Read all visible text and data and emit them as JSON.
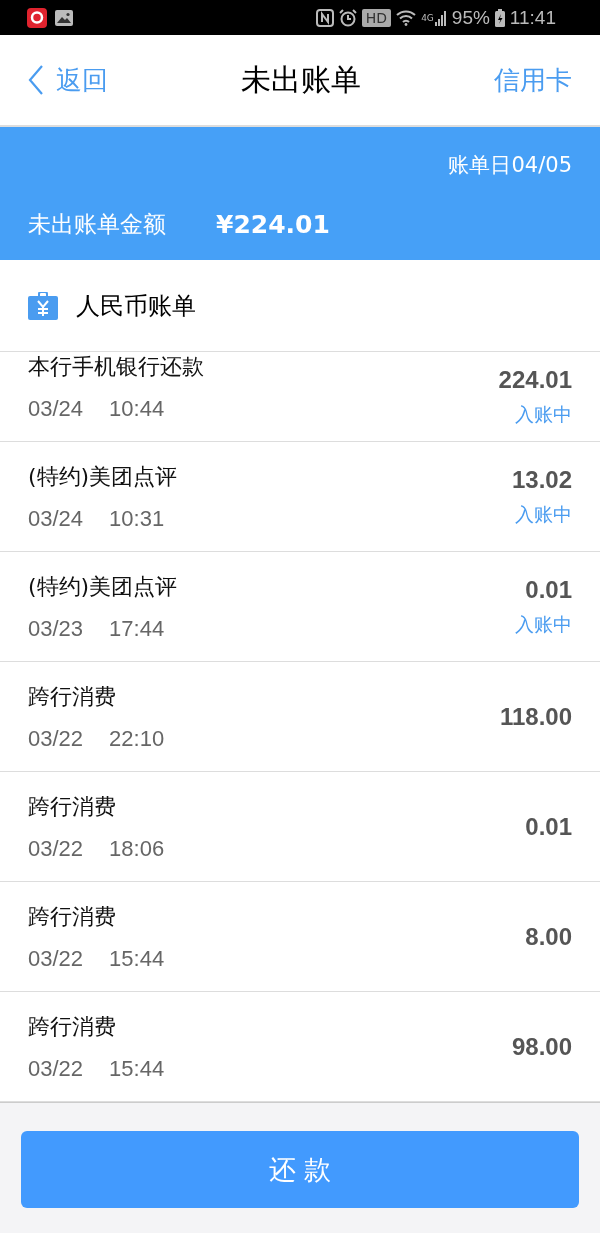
{
  "status_bar": {
    "network": "4G",
    "hd": "HD",
    "battery": "95%",
    "time": "11:41"
  },
  "nav": {
    "back": "返回",
    "title": "未出账单",
    "right": "信用卡"
  },
  "summary": {
    "bill_date": "账单日04/05",
    "label": "未出账单金额",
    "amount": "¥224.01"
  },
  "section": {
    "title": "人民币账单"
  },
  "transactions": [
    {
      "name": "本行手机银行还款",
      "date": "03/24",
      "time": "10:44",
      "amount": "224.01",
      "status": "入账中"
    },
    {
      "name": "(特约)美团点评",
      "date": "03/24",
      "time": "10:31",
      "amount": "13.02",
      "status": "入账中"
    },
    {
      "name": "(特约)美团点评",
      "date": "03/23",
      "time": "17:44",
      "amount": "0.01",
      "status": "入账中"
    },
    {
      "name": "跨行消费",
      "date": "03/22",
      "time": "22:10",
      "amount": "118.00"
    },
    {
      "name": "跨行消费",
      "date": "03/22",
      "time": "18:06",
      "amount": "0.01"
    },
    {
      "name": "跨行消费",
      "date": "03/22",
      "time": "15:44",
      "amount": "8.00"
    },
    {
      "name": "跨行消费",
      "date": "03/22",
      "time": "15:44",
      "amount": "98.00"
    }
  ],
  "repay_button": "还 款"
}
